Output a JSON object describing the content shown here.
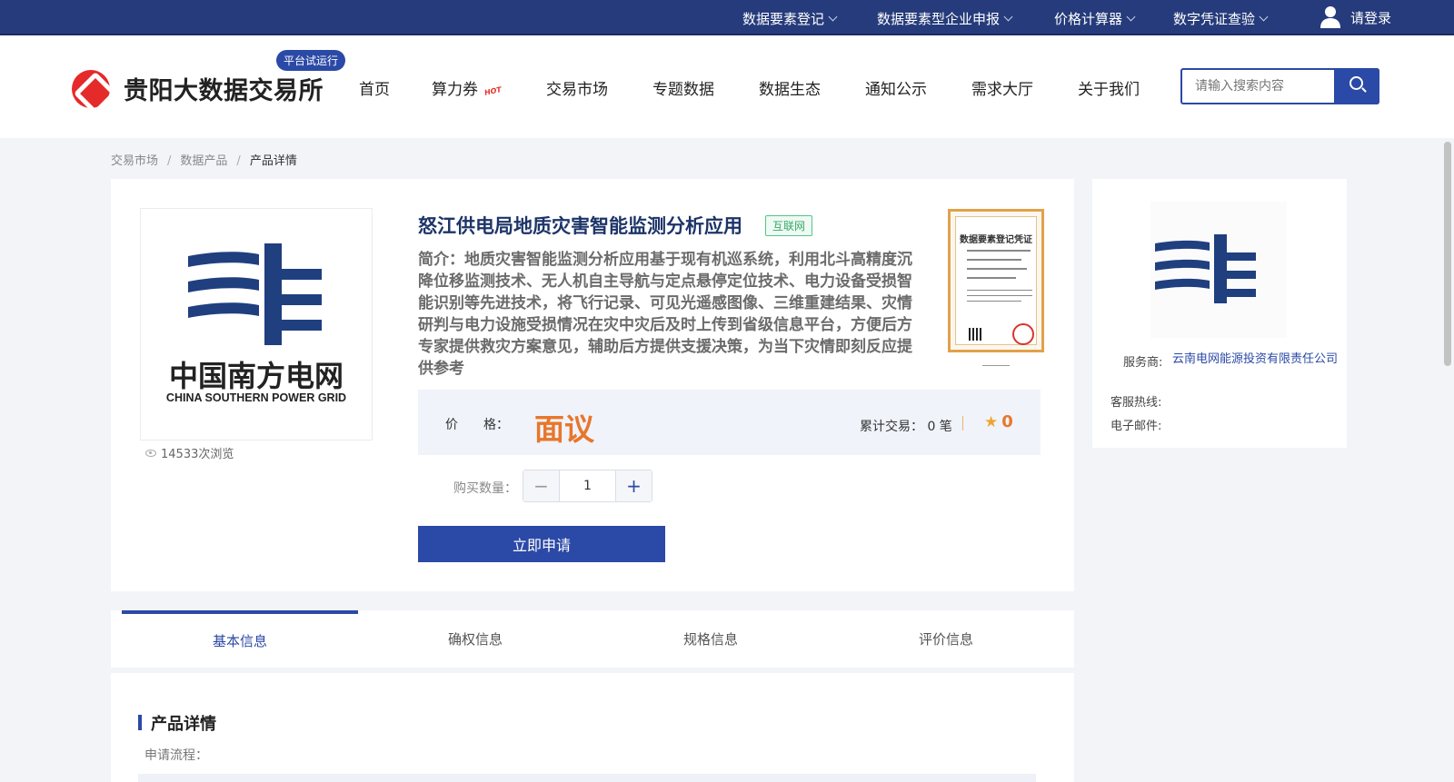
{
  "topbar": {
    "items": [
      {
        "label": "数据要素登记"
      },
      {
        "label": "数据要素型企业申报"
      },
      {
        "label": "价格计算器"
      },
      {
        "label": "数字凭证查验"
      }
    ],
    "login": "请登录"
  },
  "header": {
    "site_name": "贵阳大数据交易所",
    "trial_badge": "平台试运行",
    "nav": [
      "首页",
      "算力券",
      "交易市场",
      "专题数据",
      "数据生态",
      "通知公示",
      "需求大厅",
      "关于我们"
    ],
    "hot_badge": "HOT",
    "search_placeholder": "请输入搜索内容"
  },
  "breadcrumb": [
    "交易市场",
    "数据产品",
    "产品详情"
  ],
  "product": {
    "image_logo_cn": "中国南方电网",
    "image_logo_en": "CHINA SOUTHERN POWER GRID",
    "views": "14533次浏览",
    "title": "怒江供电局地质灾害智能监测分析应用",
    "tag": "互联网",
    "description": "简介：地质灾害智能监测分析应用基于现有机巡系统，利用北斗高精度沉降位移监测技术、无人机自主导航与定点悬停定位技术、电力设备受损智能识别等先进技术，将飞行记录、可见光遥感图像、三维重建结果、灾情研判与电力设施受损情况在灾中灾后及时上传到省级信息平台，方便后方专家提供救灾方案意见，辅助后方提供支援决策，为当下灾情即刻反应提供参考",
    "certificate_title": "数据要素登记凭证",
    "price_label": "价　　格：",
    "price": "面议",
    "deals": "累计交易：  0 笔",
    "rating": "0",
    "qty_label": "购买数量：",
    "qty_value": "1",
    "apply_button": "立即申请"
  },
  "provider": {
    "service_label": "服务商:",
    "service_value": "云南电网能源投资有限责任公司",
    "hotline_label": "客服热线:",
    "email_label": "电子邮件:"
  },
  "tabs": [
    "基本信息",
    "确权信息",
    "规格信息",
    "评价信息"
  ],
  "details": {
    "heading": "产品详情",
    "process_label": "申请流程："
  },
  "colors": {
    "primary": "#2b49a6",
    "topbar": "#263b7b",
    "price": "#e8762b",
    "brand_red": "#e52a2a"
  }
}
